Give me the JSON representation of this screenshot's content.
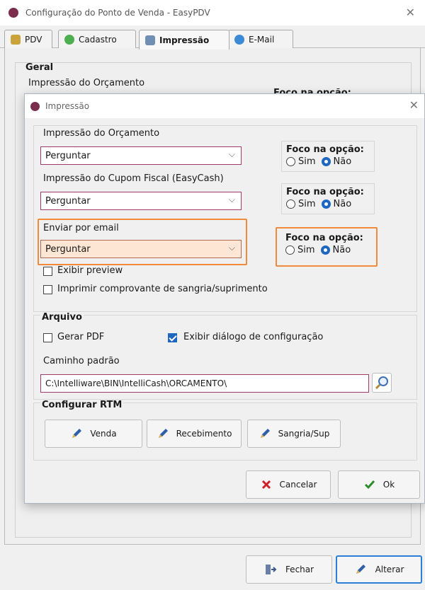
{
  "window": {
    "title": "Configuração do Ponto de Venda - EasyPDV",
    "close_glyph": "✕"
  },
  "tabs": [
    {
      "label": "PDV",
      "icon": "pdv-icon"
    },
    {
      "label": "Cadastro",
      "icon": "cadastro-icon"
    },
    {
      "label": "Impressão",
      "icon": "printer-icon",
      "active": true
    },
    {
      "label": "E-Mail",
      "icon": "email-icon"
    }
  ],
  "background": {
    "geral": "Geral",
    "impressao_orcamento": "Impressão do Orçamento",
    "foco": "Foco na opção:"
  },
  "dialog": {
    "title": "Impressão",
    "close_glyph": "✕",
    "orcamento": {
      "label": "Impressão do Orçamento",
      "value": "Perguntar"
    },
    "cupom": {
      "label": "Impressão do Cupom Fiscal (EasyCash)",
      "value": "Perguntar"
    },
    "email": {
      "label": "Enviar por email",
      "value": "Perguntar"
    },
    "foco": {
      "title": "Foco na opção:",
      "sim": "Sim",
      "nao": "Não"
    },
    "exibir_preview": "Exibir preview",
    "imprimir_comprovante": "Imprimir comprovante de sangria/suprimento",
    "arquivo": {
      "title": "Arquivo",
      "gerar_pdf": "Gerar PDF",
      "exibir_dialogo": "Exibir diálogo de configuração",
      "caminho_label": "Caminho padrão",
      "caminho_value": "C:\\Intelliware\\BIN\\IntelliCash\\ORCAMENTO\\"
    },
    "rtm": {
      "title": "Configurar RTM",
      "venda": "Venda",
      "recebimento": "Recebimento",
      "sangria": "Sangria/Sup"
    },
    "buttons": {
      "cancelar": "Cancelar",
      "ok": "Ok"
    }
  },
  "footer": {
    "fechar": "Fechar",
    "alterar": "Alterar"
  },
  "colors": {
    "accent": "#1f66c1",
    "highlight": "#f28a3e",
    "brand": "#7b2d4e"
  }
}
